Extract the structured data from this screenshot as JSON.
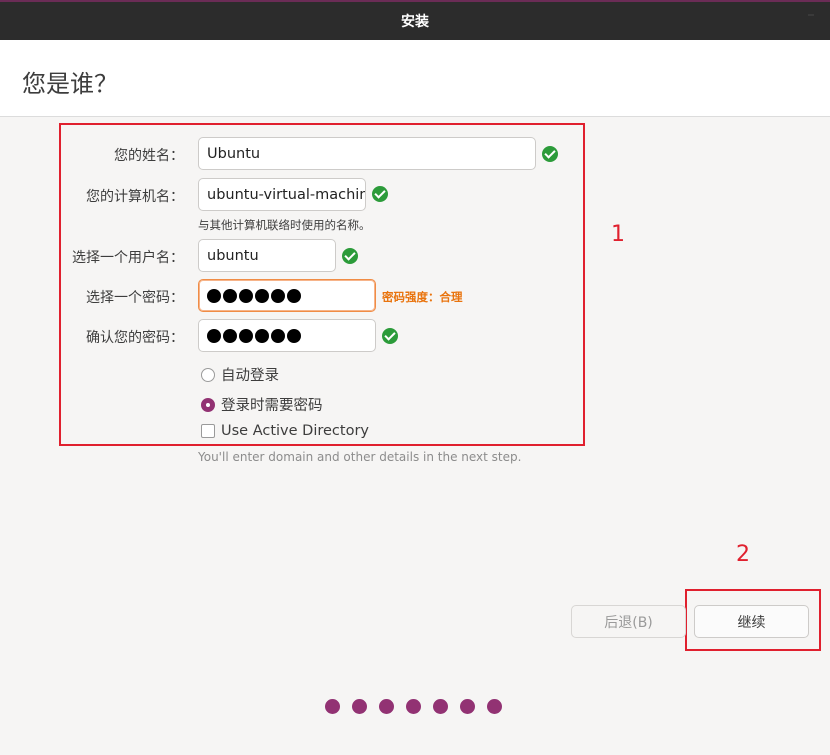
{
  "window": {
    "title": "安装"
  },
  "header": {
    "title": "您是谁？"
  },
  "form": {
    "name_label": "您的姓名：",
    "name_value": "Ubuntu",
    "computer_label": "您的计算机名：",
    "computer_value": "ubuntu-virtual-machine",
    "computer_hint": "与其他计算机联络时使用的名称。",
    "username_label": "选择一个用户名：",
    "username_value": "ubuntu",
    "password_label": "选择一个密码：",
    "password_strength": "密码强度：合理",
    "confirm_label": "确认您的密码：",
    "auto_login": "自动登录",
    "require_password": "登录时需要密码",
    "active_directory": "Use Active Directory",
    "ad_hint": "You'll enter domain and other details in the next step."
  },
  "annotations": {
    "one": "1",
    "two": "2"
  },
  "buttons": {
    "back": "后退(B)",
    "continue": "继续"
  },
  "pager": {
    "total": 7
  },
  "colors": {
    "accent": "#923273",
    "ok": "#2c9b3a",
    "warn": "#e9740e",
    "annotation": "#e0202e"
  }
}
